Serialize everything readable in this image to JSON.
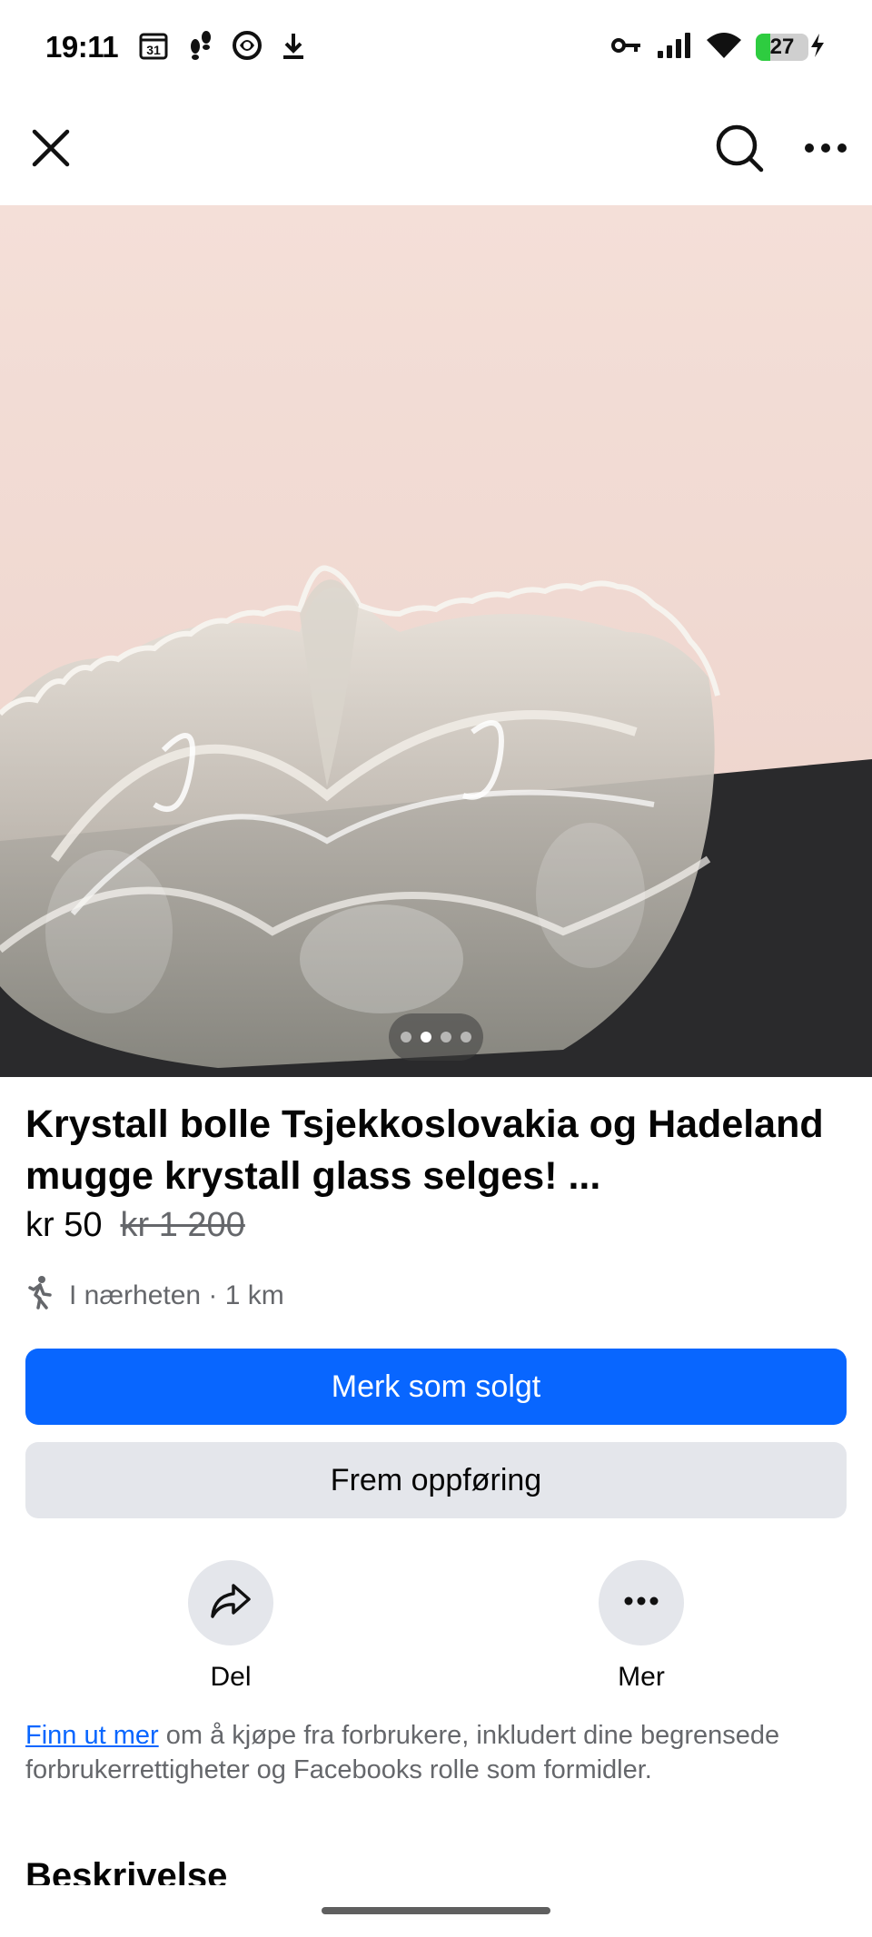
{
  "status_bar": {
    "time": "19:11",
    "calendar_day": "31",
    "battery_percent": "27",
    "battery_level": 0.27,
    "left_icons": [
      "calendar-icon",
      "footsteps-icon",
      "app-badge-icon",
      "download-icon"
    ],
    "right_icons": [
      "vpn-key-icon",
      "signal-icon",
      "wifi-icon",
      "battery-icon",
      "charging-icon"
    ]
  },
  "top_bar": {
    "icons": [
      "close-icon",
      "search-icon",
      "more-icon"
    ]
  },
  "photo": {
    "pager_count": 4,
    "pager_active_index": 1
  },
  "listing": {
    "title": "Krystall bolle Tsjekkoslovakia og Hadeland  mugge krystall glass selges! ...",
    "price": "kr 50",
    "old_price": "kr 1 200",
    "location": "I nærheten · 1 km"
  },
  "buttons": {
    "mark_sold": "Merk som solgt",
    "promote": "Frem oppføring"
  },
  "actions": {
    "share": "Del",
    "more": "Mer"
  },
  "info": {
    "link": "Finn ut mer",
    "text": " om å kjøpe fra forbrukere, inkludert dine begrensede forbrukerrettigheter og Facebooks rolle som formidler."
  },
  "section": {
    "description_title": "Beskrivelse"
  },
  "colors": {
    "accent": "#0866ff",
    "secondary_button": "#e4e6eb",
    "muted_text": "#65676b",
    "battery_green": "#2ecc40"
  }
}
